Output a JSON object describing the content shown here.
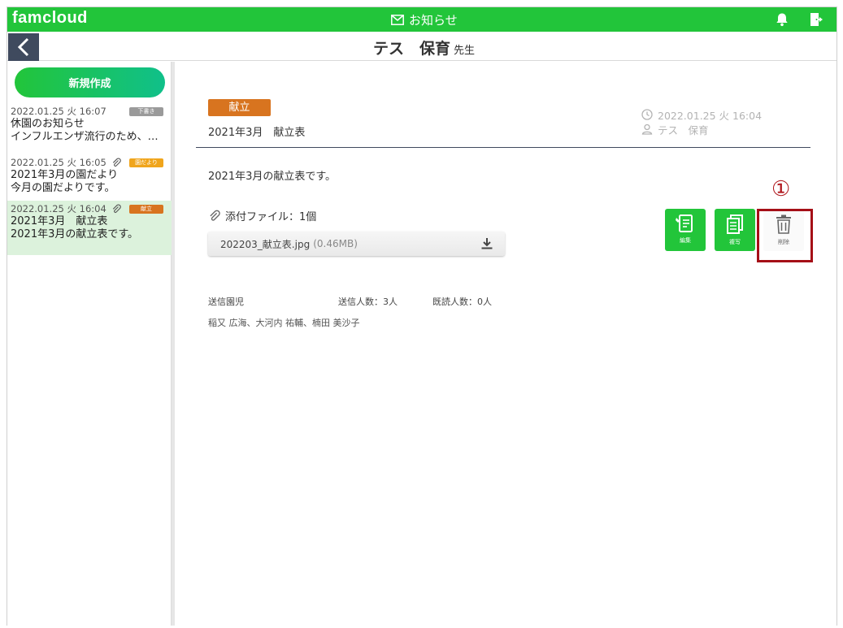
{
  "app": {
    "logo": "famcloud",
    "section_title": "お知らせ"
  },
  "header": {
    "user_name": "テス　保育",
    "user_suffix": "先生"
  },
  "sidebar": {
    "new_button_label": "新規作成",
    "messages": [
      {
        "date": "2022.01.25 火 16:07",
        "badge": "下書き",
        "badge_color": "#9a9a9a",
        "has_attachment": false,
        "line1": "休園のお知らせ",
        "line2": "インフルエンザ流行のため、…"
      },
      {
        "date": "2022.01.25 火 16:05",
        "badge": "園だより",
        "badge_color": "#f0a51c",
        "has_attachment": true,
        "line1": "2021年3月の園だより",
        "line2": "今月の園だよりです。"
      },
      {
        "date": "2022.01.25 火 16:04",
        "badge": "献立",
        "badge_color": "#d8741f",
        "has_attachment": true,
        "line1": "2021年3月　献立表",
        "line2": "2021年3月の献立表です。",
        "selected": true
      }
    ]
  },
  "detail": {
    "category": "献立",
    "category_color": "#d8741f",
    "title": "2021年3月　献立表",
    "datetime": "2022.01.25 火 16:04",
    "author": "テス　保育",
    "body": "2021年3月の献立表です。",
    "attachment_label": "添付ファイル：1個",
    "file_name": "202203_献立表.jpg",
    "file_size": "(0.46MB)",
    "actions": {
      "edit": "編集",
      "copy": "複写",
      "delete": "削除"
    },
    "recipients_label": "送信園児",
    "sent_count": "送信人数：3人",
    "read_count": "既読人数：0人",
    "recipient_names": "稲又 広海、大河内 祐輔、楠田 美沙子"
  },
  "annotation": {
    "marker": "①"
  },
  "colors": {
    "brand_green": "#22c53a",
    "nav_dark": "#3f4a5e",
    "callout_red": "#a50f17"
  }
}
